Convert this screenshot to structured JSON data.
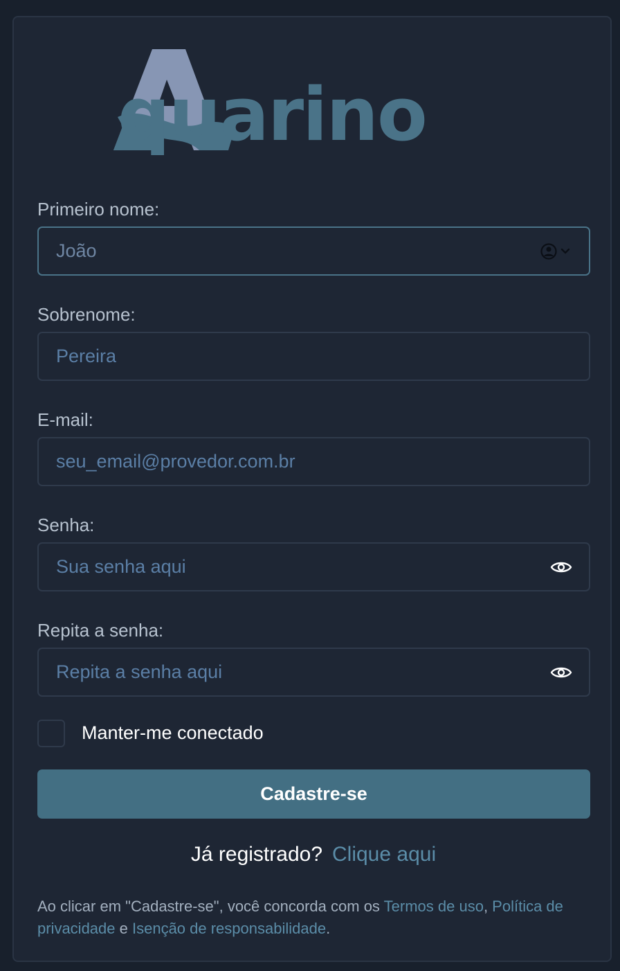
{
  "brand": {
    "logo_letter": "A",
    "logo_rest": "quarino",
    "colors": {
      "primary": "#436f83",
      "logo_light": "#8796b4",
      "logo_dark": "#4a7388",
      "link": "#5b8da8",
      "background": "#1e2634"
    }
  },
  "form": {
    "first_name": {
      "label": "Primeiro nome:",
      "placeholder": "João",
      "trailing_icon": "user-circle-chevron-icon"
    },
    "last_name": {
      "label": "Sobrenome:",
      "placeholder": "Pereira"
    },
    "email": {
      "label": "E-mail:",
      "placeholder": "seu_email@provedor.com.br"
    },
    "password": {
      "label": "Senha:",
      "placeholder": "Sua senha aqui",
      "trailing_icon": "eye-icon"
    },
    "password_repeat": {
      "label": "Repita a senha:",
      "placeholder": "Repita a senha aqui",
      "trailing_icon": "eye-icon"
    },
    "remember": {
      "label": "Manter-me conectado",
      "checked": false
    },
    "submit_label": "Cadastre-se"
  },
  "login": {
    "prompt": "Já registrado?",
    "link": "Clique aqui"
  },
  "terms": {
    "prefix": "Ao clicar em \"Cadastre-se\", você concorda com os ",
    "terms_link": "Termos de uso",
    "sep1": ", ",
    "privacy_link": "Política de privacidade",
    "sep2": " e ",
    "disclaimer_link": "Isenção de responsabilidade",
    "suffix": "."
  }
}
